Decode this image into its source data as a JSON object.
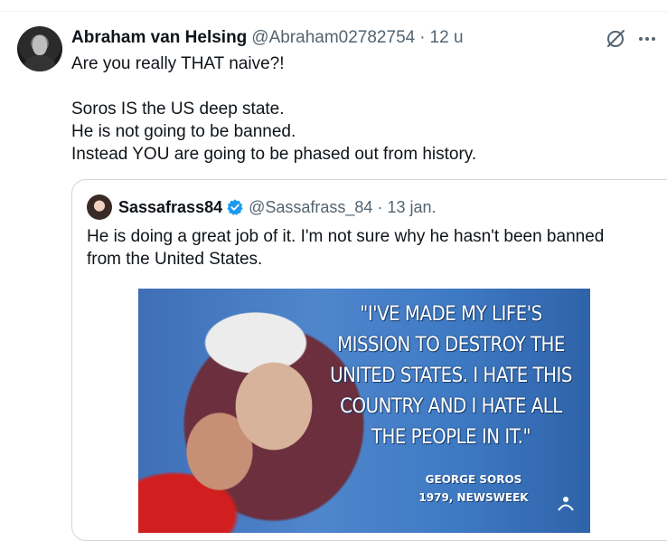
{
  "post": {
    "author_name": "Abraham van Helsing",
    "author_handle": "@Abraham02782754",
    "dot": "·",
    "time": "12 u",
    "lines": [
      "Are you really THAT naive?!",
      "",
      "Soros IS the US deep state.",
      "He is not going to be banned.",
      "Instead YOU are going to be phased out from history."
    ]
  },
  "quote": {
    "author_name": "Sassafrass84",
    "author_handle": "@Sassafrass_84",
    "dot": "·",
    "time": "13 jan.",
    "text": "He is doing a great job of it. I'm not sure why he hasn't been banned from the United States.",
    "image": {
      "quote_lines": [
        "\"I'VE MADE MY LIFE'S",
        "MISSION TO DESTROY THE",
        "UNITED STATES. I HATE THIS",
        "COUNTRY AND I HATE ALL",
        "THE PEOPLE IN IT.\""
      ],
      "attribution_name": "GEORGE SOROS",
      "attribution_source": "1979, NEWSWEEK"
    }
  },
  "icons": {
    "grok": "grok-icon",
    "more": "more-icon",
    "verified": "verified-badge-icon"
  },
  "colors": {
    "text": "#0f1419",
    "secondary": "#536471",
    "verified": "#1d9bf0",
    "border": "#cfd9de"
  }
}
